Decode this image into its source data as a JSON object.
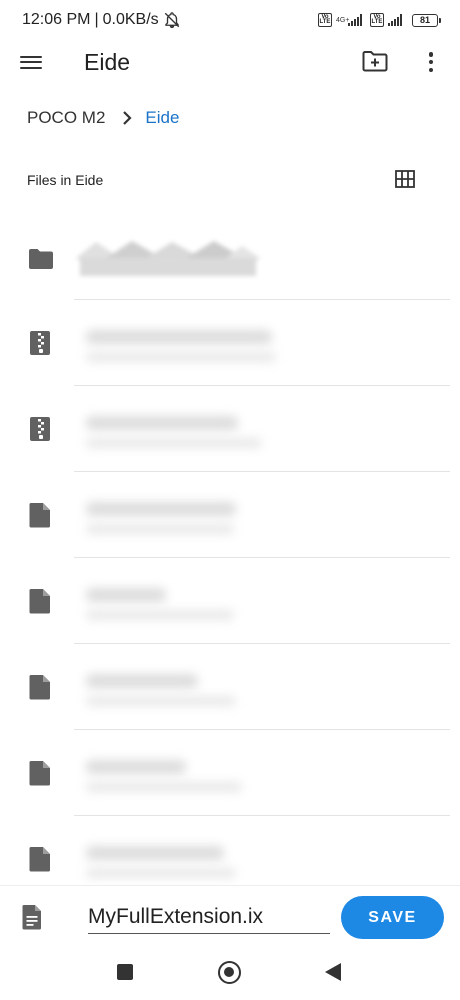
{
  "status_bar": {
    "time": "12:06 PM",
    "separator": "|",
    "speed": "0.0KB/s",
    "sim1_label": "Vo LTE",
    "sim1_network": "4G+",
    "sim2_label": "Vo LTE",
    "battery": "81"
  },
  "app_bar": {
    "title": "Eide",
    "icons": [
      "menu-icon",
      "new-folder-icon",
      "more-vert-icon"
    ]
  },
  "breadcrumb": {
    "root": "POCO M2",
    "separator": ">",
    "current": "Eide"
  },
  "files_header": {
    "label": "Files in Eide",
    "view_toggle_icon": "grid-view-icon"
  },
  "files": [
    {
      "icon": "folder-icon"
    },
    {
      "icon": "zip-file-icon"
    },
    {
      "icon": "zip-file-icon"
    },
    {
      "icon": "file-icon"
    },
    {
      "icon": "file-icon"
    },
    {
      "icon": "file-icon"
    },
    {
      "icon": "file-icon"
    },
    {
      "icon": "file-icon"
    }
  ],
  "save_bar": {
    "file_icon": "document-icon",
    "filename_value": "MyFullExtension.ix",
    "save_label": "SAVE"
  },
  "colors": {
    "accent": "#1e88e5",
    "breadcrumb_current": "#1a73c8",
    "icon": "#616161"
  }
}
